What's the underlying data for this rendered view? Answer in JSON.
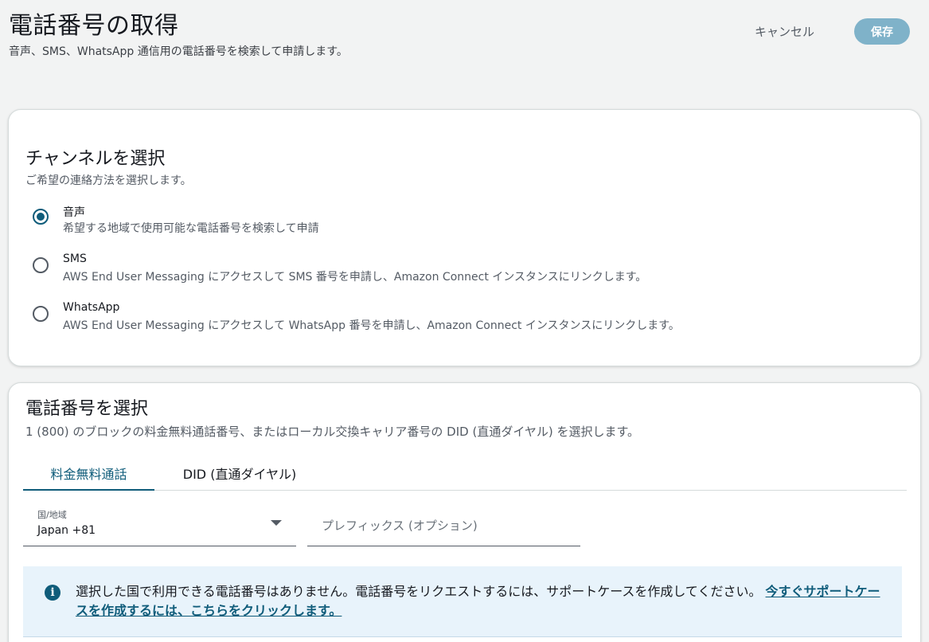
{
  "header": {
    "title": "電話番号の取得",
    "subtitle": "音声、SMS、WhatsApp 通信用の電話番号を検索して申請します。",
    "cancel_label": "キャンセル",
    "save_label": "保存"
  },
  "channel_section": {
    "heading": "チャンネルを選択",
    "description": "ご希望の連絡方法を選択します。",
    "options": [
      {
        "label": "音声",
        "description": "希望する地域で使用可能な電話番号を検索して申請",
        "selected": true
      },
      {
        "label": "SMS",
        "description": "AWS End User Messaging にアクセスして SMS 番号を申請し、Amazon Connect インスタンスにリンクします。",
        "selected": false
      },
      {
        "label": "WhatsApp",
        "description": "AWS End User Messaging にアクセスして WhatsApp 番号を申請し、Amazon Connect インスタンスにリンクします。",
        "selected": false
      }
    ]
  },
  "phone_section": {
    "heading": "電話番号を選択",
    "description": "1 (800) のブロックの料金無料通話番号、またはローカル交換キャリア番号の DID (直通ダイヤル) を選択します。",
    "tabs": [
      {
        "label": "料金無料通話",
        "active": true
      },
      {
        "label": "DID (直通ダイヤル)",
        "active": false
      }
    ],
    "country_field": {
      "label": "国/地域",
      "value": "Japan +81"
    },
    "prefix_field": {
      "placeholder": "プレフィックス (オプション)",
      "value": ""
    },
    "info": {
      "icon": "info-icon",
      "message": "選択した国で利用できる電話番号はありません。電話番号をリクエストするには、サポートケースを作成してください。",
      "link_text": "今すぐサポートケースを作成するには、こちらをクリックします。"
    }
  },
  "colors": {
    "accent": "#0f5c7a",
    "save_button_bg": "#7fb2c9",
    "info_bg": "#e8f3fb",
    "page_bg": "#f2f3f3"
  }
}
